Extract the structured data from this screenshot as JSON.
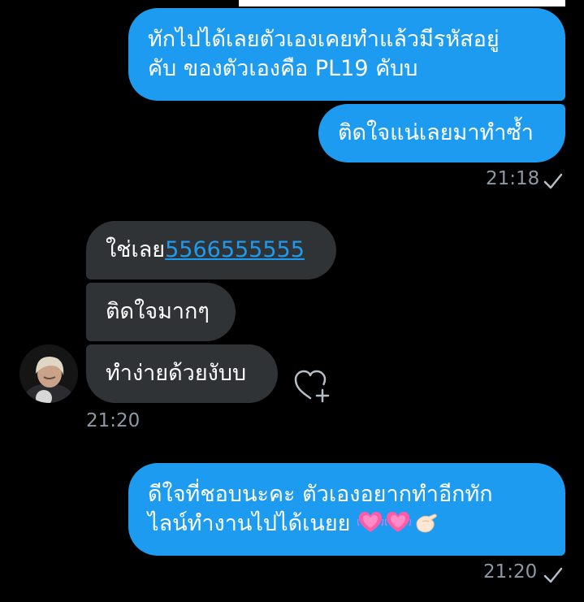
{
  "messages": {
    "out1": {
      "line1": "ทักไปได้เลยตัวเองเคยทำแล้วมีรหัสอยู่",
      "line2": "คับ ของตัวเองคือ PL19 คับบ"
    },
    "out2": {
      "text": "ติดใจแน่เลยมาทำซ้ำ"
    },
    "time1": "21:18",
    "in1": {
      "text": "ใช่เลย",
      "link": "5566555555"
    },
    "in2": {
      "text": "ติดใจมากๆ"
    },
    "in3": {
      "text": "ทำง่ายด้วยงับบ"
    },
    "time2": "21:20",
    "out3": {
      "line1": "ดีใจที่ชอบนะคะ ตัวเองอยากทำอีกทัก",
      "line2": "ไลน์ทำงานไปได้เนยย"
    },
    "time3": "21:20"
  },
  "icons": {
    "read": "check-icon",
    "react": "heart-plus-icon",
    "emoji": [
      "heart-emoji",
      "heart-emoji",
      "pinch-hand-emoji"
    ]
  },
  "colors": {
    "outgoing": "#1d9bf0",
    "incoming": "#2f3336",
    "background": "#000000",
    "timestamp": "#8b98a5"
  }
}
